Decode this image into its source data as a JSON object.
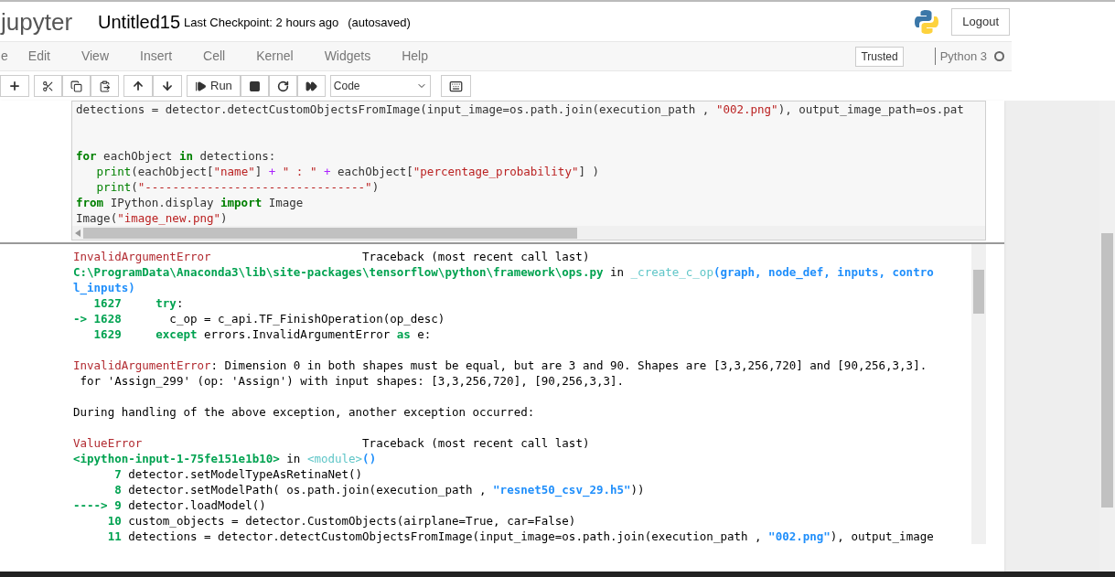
{
  "header": {
    "logo": "jupyter",
    "notebook_name": "Untitled15",
    "checkpoint": "Last Checkpoint: 2 hours ago",
    "autosave": "(autosaved)",
    "logout": "Logout"
  },
  "menu": [
    "e",
    "Edit",
    "View",
    "Insert",
    "Cell",
    "Kernel",
    "Widgets",
    "Help"
  ],
  "trusted": "Trusted",
  "kernel": {
    "name": "Python 3",
    "busy": false
  },
  "toolbar": {
    "run": "Run",
    "cell_type": "Code"
  },
  "code_cell": {
    "lines": [
      {
        "segs": [
          {
            "text": "detections = detector.detectCustomObjectsFromImage(input_image=os.path.join(execution_path , ",
            "kind": "plain"
          },
          {
            "text": "\"002.png\"",
            "kind": "string"
          },
          {
            "text": "), output_image_path=os.pat",
            "kind": "plain"
          }
        ],
        "blank_after": true
      },
      {
        "blank_before": true,
        "segs": [
          {
            "text": "for",
            "kind": "keyword"
          },
          {
            "text": " eachObject ",
            "kind": "plain"
          },
          {
            "text": "in",
            "kind": "keyword"
          },
          {
            "text": " detections:",
            "kind": "plain"
          }
        ]
      },
      {
        "segs": [
          {
            "text": "   print",
            "kind": "builtin"
          },
          {
            "text": "(eachObject[",
            "kind": "plain"
          },
          {
            "text": "\"name\"",
            "kind": "string"
          },
          {
            "text": "] ",
            "kind": "plain"
          },
          {
            "text": "+",
            "kind": "operator"
          },
          {
            "text": " \" : \" ",
            "kind": "string"
          },
          {
            "text": "+",
            "kind": "operator"
          },
          {
            "text": " eachObject[",
            "kind": "plain"
          },
          {
            "text": "\"percentage_probability\"",
            "kind": "string"
          },
          {
            "text": "] )",
            "kind": "plain"
          }
        ]
      },
      {
        "segs": [
          {
            "text": "   print",
            "kind": "builtin"
          },
          {
            "text": "(",
            "kind": "plain"
          },
          {
            "text": "\"--------------------------------\"",
            "kind": "string"
          },
          {
            "text": ")",
            "kind": "plain"
          }
        ]
      },
      {
        "segs": [
          {
            "text": "from",
            "kind": "keyword"
          },
          {
            "text": " IPython.display ",
            "kind": "plain"
          },
          {
            "text": "import",
            "kind": "keyword"
          },
          {
            "text": " Image",
            "kind": "plain"
          }
        ]
      },
      {
        "segs": [
          {
            "text": "Image(",
            "kind": "plain"
          },
          {
            "text": "\"image_new.png\"",
            "kind": "string"
          },
          {
            "text": ")",
            "kind": "plain"
          }
        ]
      }
    ]
  },
  "output": {
    "lines": [
      {
        "segs": [
          {
            "text": "InvalidArgumentError",
            "kind": "red"
          },
          {
            "text": "                      Traceback (most recent call last)",
            "kind": "plain"
          }
        ]
      },
      {
        "segs": [
          {
            "text": "C:\\ProgramData\\Anaconda3\\lib\\site-packages\\tensorflow\\python\\framework\\ops.py",
            "kind": "green"
          },
          {
            "text": " in ",
            "kind": "plain"
          },
          {
            "text": "_create_c_op",
            "kind": "cyan"
          },
          {
            "text": "(graph, node_def, inputs, contro",
            "kind": "blue"
          }
        ]
      },
      {
        "segs": [
          {
            "text": "l_inputs)",
            "kind": "blue"
          }
        ]
      },
      {
        "segs": [
          {
            "text": "   1627 ",
            "kind": "green"
          },
          {
            "text": "    try",
            "kind": "green"
          },
          {
            "text": ":",
            "kind": "plain"
          }
        ]
      },
      {
        "segs": [
          {
            "text": "-> 1628 ",
            "kind": "green"
          },
          {
            "text": "      c_op = c_api.TF_FinishOperation(op_desc)",
            "kind": "plain"
          }
        ]
      },
      {
        "segs": [
          {
            "text": "   1629 ",
            "kind": "green"
          },
          {
            "text": "    except",
            "kind": "green"
          },
          {
            "text": " errors.InvalidArgumentError ",
            "kind": "plain"
          },
          {
            "text": "as",
            "kind": "green"
          },
          {
            "text": " e:",
            "kind": "plain"
          }
        ]
      },
      {
        "blank_before": true,
        "segs": [
          {
            "text": "InvalidArgumentError",
            "kind": "red"
          },
          {
            "text": ": Dimension 0 in both shapes must be equal, but are 3 and 90. Shapes are [3,3,256,720] and [90,256,3,3].",
            "kind": "plain"
          }
        ]
      },
      {
        "segs": [
          {
            "text": " for 'Assign_299' (op: 'Assign') with input shapes: [3,3,256,720], [90,256,3,3].",
            "kind": "plain"
          }
        ]
      },
      {
        "blank_before": true,
        "segs": [
          {
            "text": "During handling of the above exception, another exception occurred:",
            "kind": "plain"
          }
        ]
      },
      {
        "blank_before": true,
        "segs": [
          {
            "text": "ValueError",
            "kind": "red"
          },
          {
            "text": "                                Traceback (most recent call last)",
            "kind": "plain"
          }
        ]
      },
      {
        "segs": [
          {
            "text": "<ipython-input-1-75fe151e1b10>",
            "kind": "green"
          },
          {
            "text": " in ",
            "kind": "plain"
          },
          {
            "text": "<module>",
            "kind": "cyan"
          },
          {
            "text": "()",
            "kind": "blue"
          }
        ]
      },
      {
        "segs": [
          {
            "text": "      7 ",
            "kind": "green"
          },
          {
            "text": "detector.setModelTypeAsRetinaNet()",
            "kind": "plain"
          }
        ]
      },
      {
        "segs": [
          {
            "text": "      8 ",
            "kind": "green"
          },
          {
            "text": "detector.setModelPath( os.path.join(execution_path , ",
            "kind": "plain"
          },
          {
            "text": "\"resnet50_csv_29.h5\"",
            "kind": "blue"
          },
          {
            "text": "))",
            "kind": "plain"
          }
        ]
      },
      {
        "segs": [
          {
            "text": "----> 9 ",
            "kind": "green"
          },
          {
            "text": "detector.loadModel()",
            "kind": "plain"
          }
        ]
      },
      {
        "segs": [
          {
            "text": "     10 ",
            "kind": "green"
          },
          {
            "text": "custom_objects = detector.CustomObjects(airplane=True, car=False)",
            "kind": "plain"
          }
        ]
      },
      {
        "segs": [
          {
            "text": "     11 ",
            "kind": "green"
          },
          {
            "text": "detections = detector.detectCustomObjectsFromImage(input_image=os.path.join(execution_path , ",
            "kind": "plain"
          },
          {
            "text": "\"002.png\"",
            "kind": "blue"
          },
          {
            "text": "), output_image",
            "kind": "plain"
          }
        ]
      }
    ]
  }
}
